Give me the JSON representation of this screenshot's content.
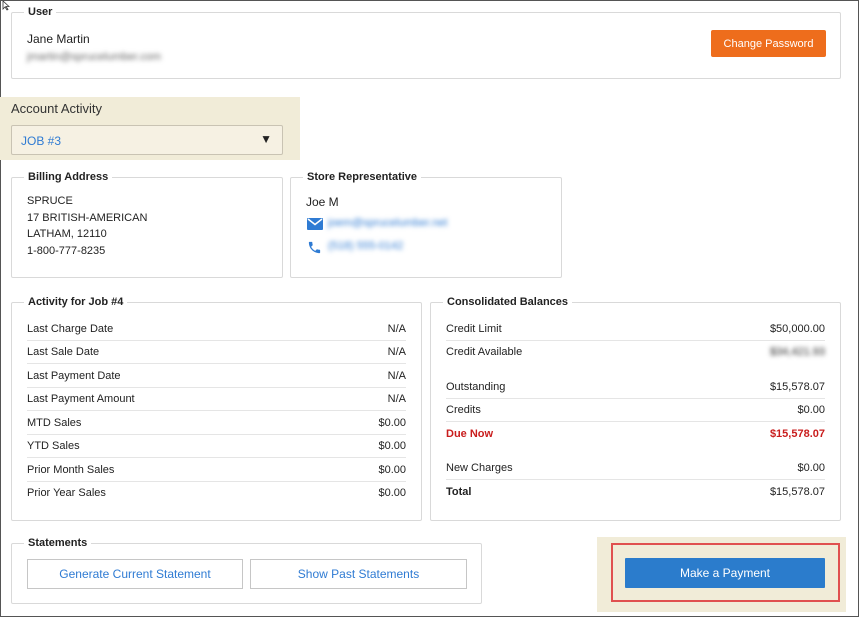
{
  "user": {
    "legend": "User",
    "name": "Jane Martin",
    "email": "jmartin@sprucelumber.com",
    "change_password_label": "Change Password"
  },
  "account_activity": {
    "label": "Account Activity",
    "selected_job": "JOB #3"
  },
  "billing_address": {
    "legend": "Billing Address",
    "lines": [
      "SPRUCE",
      "17 BRITISH-AMERICAN",
      "LATHAM, 12110",
      "1-800-777-8235"
    ]
  },
  "store_rep": {
    "legend": "Store Representative",
    "name": "Joe M",
    "email": "joem@sprucelumber.net",
    "phone": "(518) 555-0142"
  },
  "activity": {
    "legend": "Activity for Job #4",
    "rows": [
      {
        "label": "Last Charge Date",
        "value": "N/A"
      },
      {
        "label": "Last Sale Date",
        "value": "N/A"
      },
      {
        "label": "Last Payment Date",
        "value": "N/A"
      },
      {
        "label": "Last Payment Amount",
        "value": "N/A"
      },
      {
        "label": "MTD Sales",
        "value": "$0.00"
      },
      {
        "label": "YTD Sales",
        "value": "$0.00"
      },
      {
        "label": "Prior Month Sales",
        "value": "$0.00"
      },
      {
        "label": "Prior Year Sales",
        "value": "$0.00"
      }
    ]
  },
  "balances": {
    "legend": "Consolidated Balances",
    "credit_limit_label": "Credit Limit",
    "credit_limit_value": "$50,000.00",
    "credit_available_label": "Credit Available",
    "credit_available_value": "$34,421.93",
    "outstanding_label": "Outstanding",
    "outstanding_value": "$15,578.07",
    "credits_label": "Credits",
    "credits_value": "$0.00",
    "due_now_label": "Due Now",
    "due_now_value": "$15,578.07",
    "new_charges_label": "New Charges",
    "new_charges_value": "$0.00",
    "total_label": "Total",
    "total_value": "$15,578.07"
  },
  "statements": {
    "legend": "Statements",
    "generate_label": "Generate Current Statement",
    "past_label": "Show Past Statements"
  },
  "payment": {
    "make_payment_label": "Make a Payment"
  },
  "colors": {
    "accent_orange": "#ee6d1c",
    "link_blue": "#2f7bd3",
    "due_red": "#c91d1d",
    "highlight": "#f1ecd8"
  }
}
